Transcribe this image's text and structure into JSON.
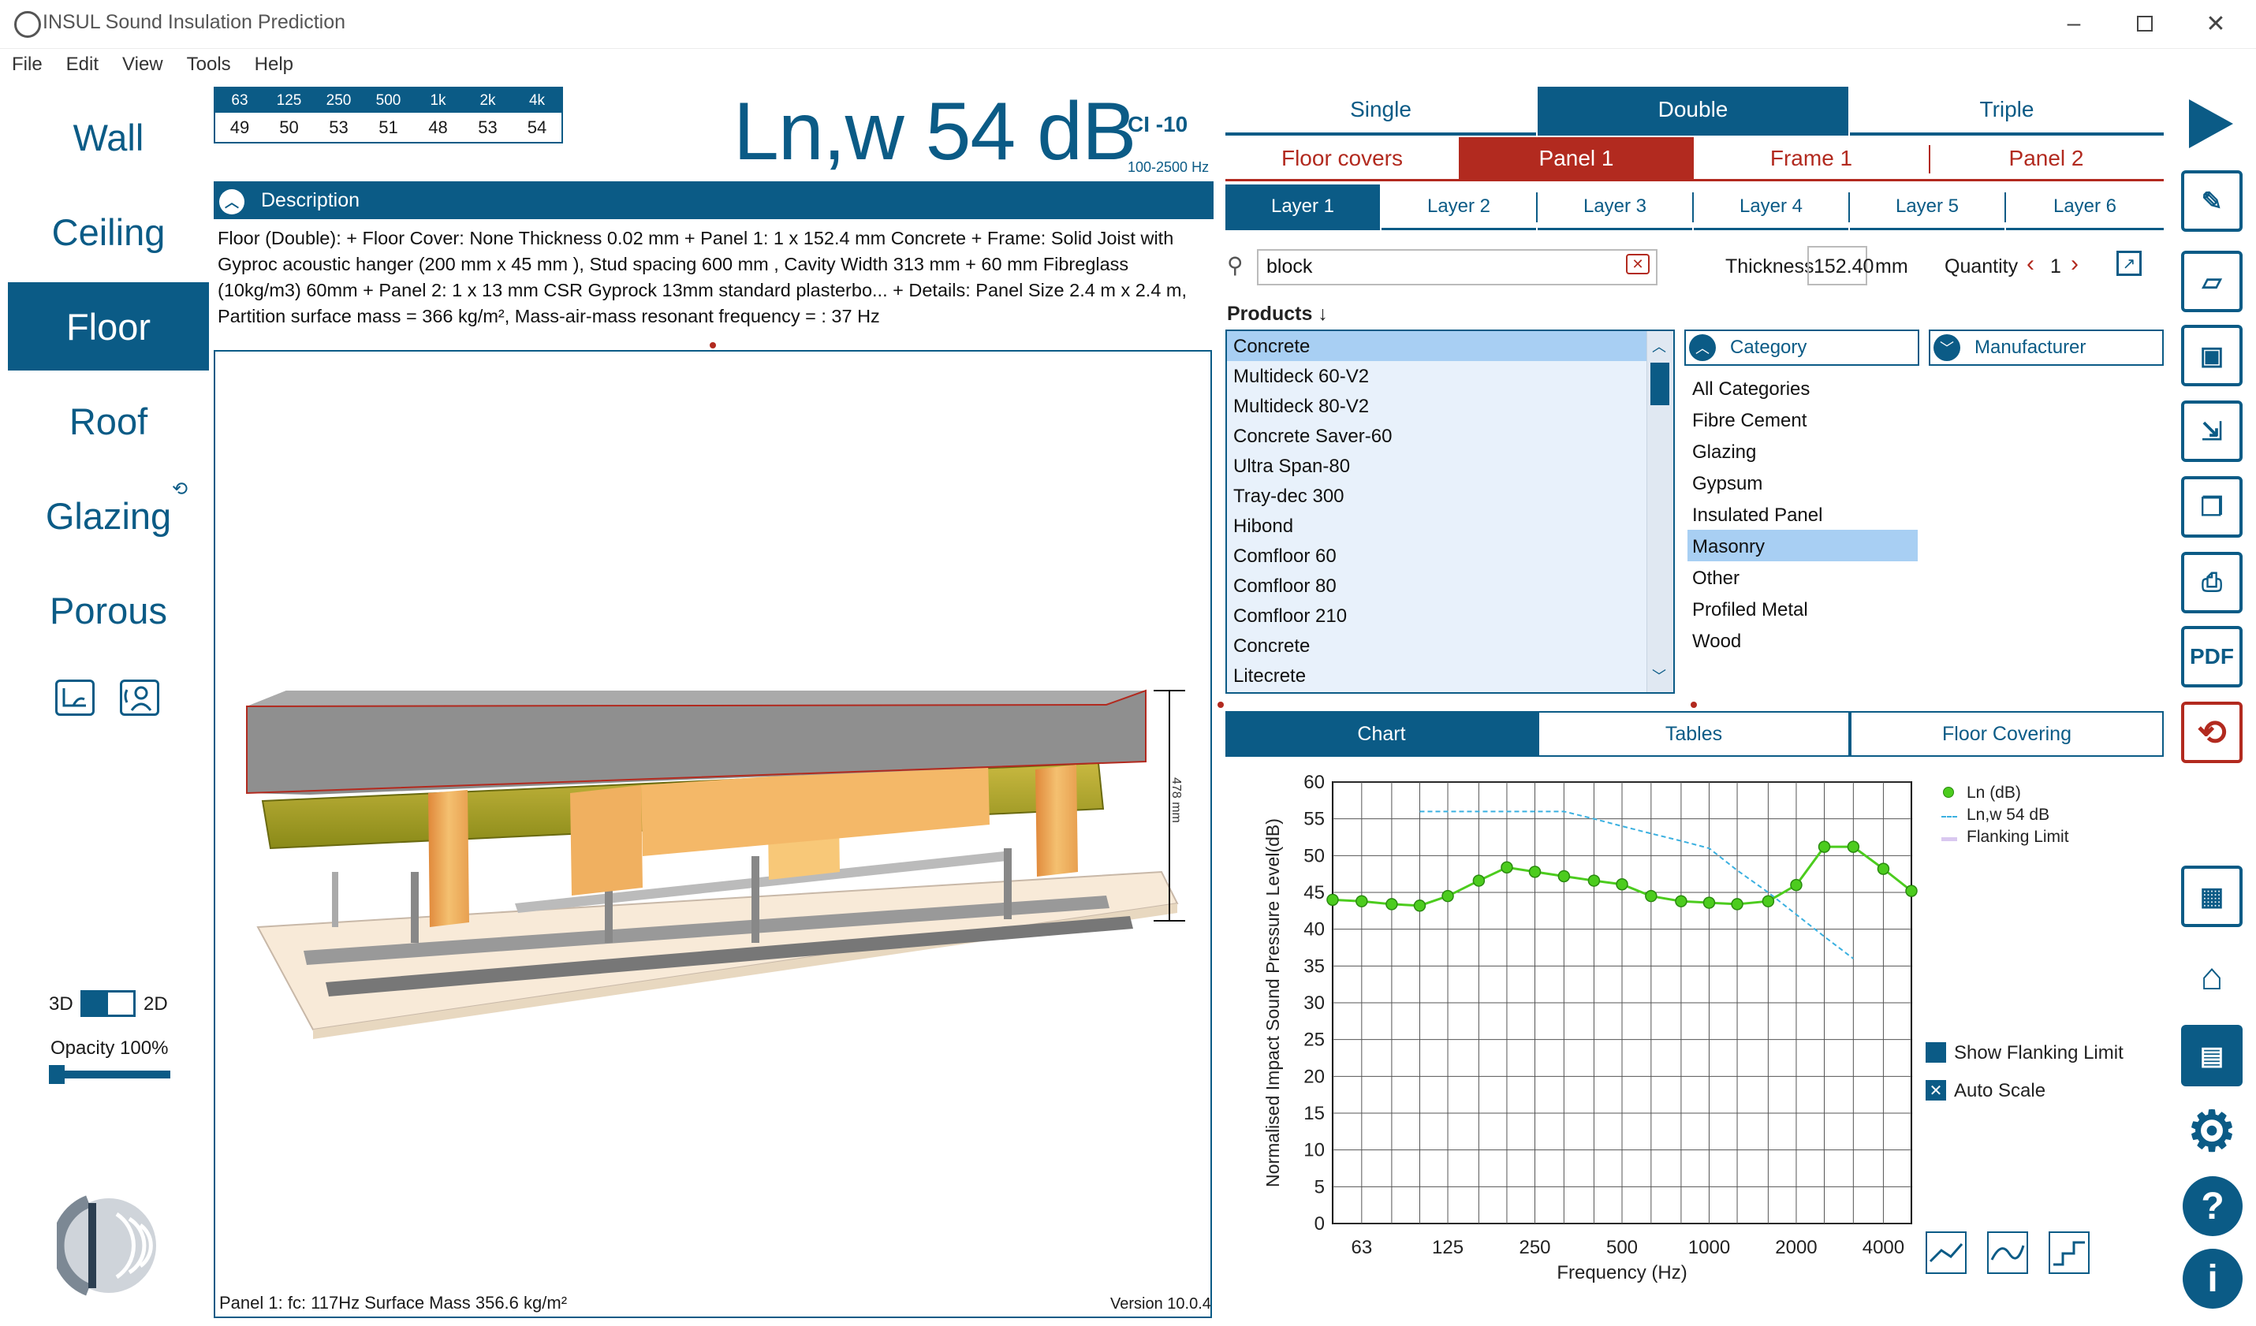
{
  "window": {
    "title": "INSUL Sound Insulation Prediction"
  },
  "menu": [
    "File",
    "Edit",
    "View",
    "Tools",
    "Help"
  ],
  "nav": [
    "Wall",
    "Ceiling",
    "Floor",
    "Roof",
    "Glazing",
    "Porous"
  ],
  "nav_active": "Floor",
  "freq_table": {
    "bands": [
      "63",
      "125",
      "250",
      "500",
      "1k",
      "2k",
      "4k"
    ],
    "values": [
      "49",
      "50",
      "53",
      "51",
      "48",
      "53",
      "54"
    ]
  },
  "rating": {
    "main": "Ln,w 54 dB",
    "ci": "CI -10",
    "range": "100-2500 Hz"
  },
  "description": {
    "title": "Description",
    "text": "Floor (Double):  + Floor Cover: None Thickness  0.02 mm  + Panel 1: 1 x 152.4 mm Concrete + Frame: Solid Joist with Gyproc acoustic hanger (200 mm x 45 mm ), Stud spacing  600 mm , Cavity Width 313 mm  + 60 mm  Fibreglass (10kg/m3) 60mm + Panel 2: 1 x 13 mm CSR Gyprock 13mm standard plasterbo... + Details: Panel Size  2.4 m x 2.4 m, Partition surface mass = 366 kg/m², Mass-air-mass resonant frequency = : 37 Hz"
  },
  "view3d": {
    "dimension_label": "478 mm",
    "panel_info": "Panel 1:  fc: 117Hz Surface Mass 356.6 kg/m²",
    "version": "Version 10.0.4"
  },
  "view_controls": {
    "label_3d": "3D",
    "label_2d": "2D",
    "opacity": "Opacity 100%",
    "opacity_value": 1.0
  },
  "construction_tabs": [
    "Single",
    "Double",
    "Triple"
  ],
  "construction_active": "Double",
  "element_tabs": [
    "Floor covers",
    "Panel 1",
    "Frame 1",
    "Panel 2"
  ],
  "element_active": "Panel 1",
  "layer_tabs": [
    "Layer 1",
    "Layer 2",
    "Layer 3",
    "Layer 4",
    "Layer 5",
    "Layer 6"
  ],
  "layer_active": "Layer 1",
  "search": {
    "value": "block"
  },
  "thickness": {
    "label": "Thickness",
    "value": "152.40",
    "unit": "mm"
  },
  "quantity": {
    "label": "Quantity",
    "value": "1"
  },
  "products": {
    "header": "Products",
    "items": [
      "Concrete",
      "Multideck 60-V2",
      "Multideck 80-V2",
      "Concrete Saver-60",
      "Ultra Span-80",
      "Tray-dec 300",
      "Hibond",
      "Comfloor 60",
      "Comfloor 80",
      "Comfloor 210",
      "Concrete",
      "Litecrete"
    ],
    "selected_index": 0
  },
  "category": {
    "label": "Category",
    "items": [
      "All Categories",
      "Fibre Cement",
      "Glazing",
      "Gypsum",
      "Insulated Panel",
      "Masonry",
      "Other",
      "Profiled Metal",
      "Wood"
    ],
    "selected": "Masonry"
  },
  "manufacturer": {
    "label": "Manufacturer"
  },
  "chart_tabs": [
    "Chart",
    "Tables",
    "Floor Covering"
  ],
  "chart_active": "Chart",
  "options": {
    "show_flanking": "Show Flanking Limit",
    "auto_scale": "Auto Scale"
  },
  "colors": {
    "primary": "#0b5b86",
    "accent_red": "#b22a1f",
    "selection": "#a8cff3",
    "ln_series": "#4ccc1e",
    "ref_curve": "#3ab0e0",
    "flanking": "#d9c8f0"
  },
  "chart_data": {
    "type": "line",
    "xlabel": "Frequency (Hz)",
    "ylabel": "Normalised Impact Sound Pressure Level(dB)",
    "ylim": [
      0,
      60
    ],
    "yticks": [
      0,
      5,
      10,
      15,
      20,
      25,
      30,
      35,
      40,
      45,
      50,
      55,
      60
    ],
    "xticks": [
      "63",
      "125",
      "250",
      "500",
      "1000",
      "2000",
      "4000"
    ],
    "x_scale": "log",
    "grid": true,
    "legend_position": "top-right",
    "series": [
      {
        "name": "Ln (dB)",
        "x": [
          50,
          63,
          80,
          100,
          125,
          160,
          200,
          250,
          315,
          400,
          500,
          630,
          800,
          1000,
          1250,
          1600,
          2000,
          2500,
          3150,
          4000,
          5000
        ],
        "values": [
          44,
          43.8,
          43.4,
          43.2,
          44.5,
          46.6,
          48.4,
          47.8,
          47.2,
          46.6,
          46.1,
          44.5,
          43.8,
          43.6,
          43.4,
          43.8,
          46,
          51.2,
          51.2,
          48.2,
          45.2
        ]
      },
      {
        "name": "Ln,w 54 dB",
        "x": [
          100,
          125,
          160,
          200,
          250,
          315,
          400,
          500,
          630,
          800,
          1000,
          1250,
          1600,
          2000,
          2500,
          3150
        ],
        "values": [
          56,
          56,
          56,
          56,
          56,
          56,
          55,
          54,
          53,
          52,
          51,
          48,
          45,
          42,
          39,
          36
        ]
      },
      {
        "name": "Flanking Limit",
        "x": [],
        "values": []
      }
    ]
  }
}
